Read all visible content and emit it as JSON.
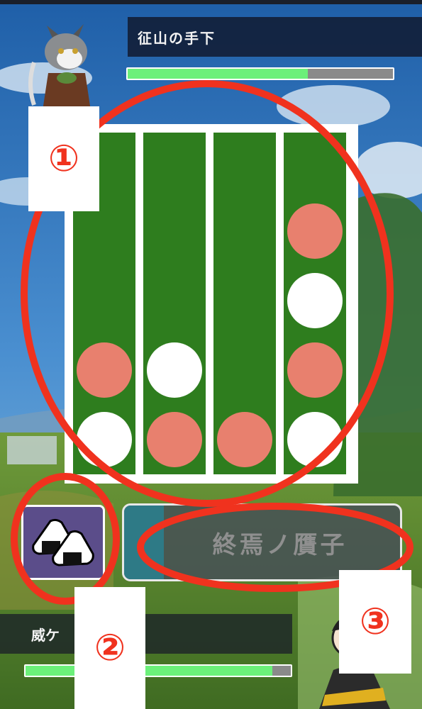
{
  "enemy": {
    "name": "征山の手下",
    "hp_fraction": 0.68
  },
  "player": {
    "name": "威ケ",
    "hp_fraction": 0.93
  },
  "board": {
    "columns": [
      {
        "pieces": [
          "white",
          "pink"
        ]
      },
      {
        "pieces": [
          "pink",
          "white"
        ]
      },
      {
        "pieces": [
          "pink"
        ]
      },
      {
        "pieces": [
          "white",
          "pink",
          "white",
          "pink"
        ]
      }
    ],
    "piece_colors": {
      "white": "#ffffff",
      "pink": "#e8806e"
    },
    "board_color": "#2e7d1e"
  },
  "item_button": {
    "icon": "onigiri-icon"
  },
  "skill_button": {
    "label": "終焉ノ贋子"
  },
  "callouts": {
    "one": "①",
    "two": "②",
    "three": "③"
  },
  "annotation_color": "#f0321e"
}
